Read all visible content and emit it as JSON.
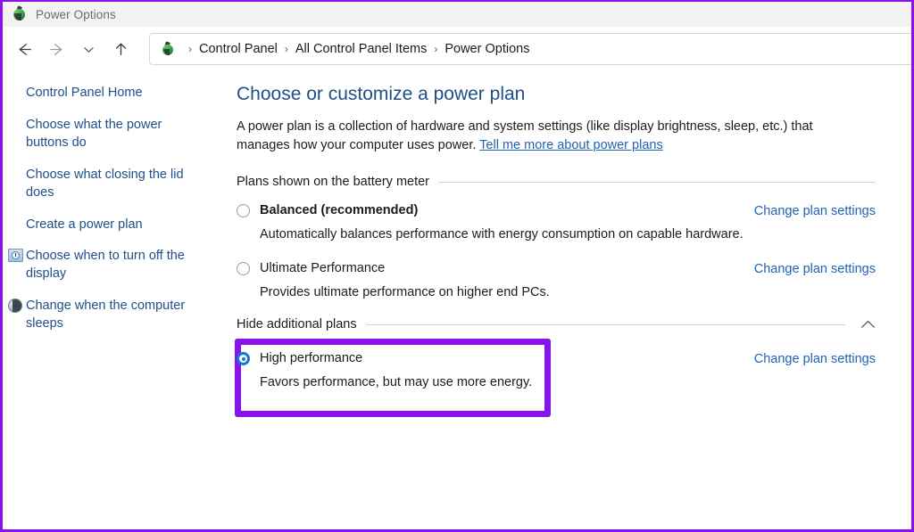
{
  "window": {
    "title": "Power Options",
    "title_icon": "power-options-icon",
    "border_color": "#8A12EC"
  },
  "toolbar": {
    "back": "back-arrow",
    "forward": "forward-arrow",
    "recent": "recent-locations-chevron",
    "up": "up-arrow",
    "breadcrumb": {
      "icon": "control-panel-icon",
      "separator": "›",
      "items": [
        "Control Panel",
        "All Control Panel Items",
        "Power Options"
      ]
    }
  },
  "sidebar": {
    "items": [
      {
        "label": "Control Panel Home",
        "icon": null
      },
      {
        "label": "Choose what the power buttons do",
        "icon": null
      },
      {
        "label": "Choose what closing the lid does",
        "icon": null
      },
      {
        "label": "Create a power plan",
        "icon": null
      },
      {
        "label": "Choose when to turn off the display",
        "icon": "display-clock-icon"
      },
      {
        "label": "Change when the computer sleeps",
        "icon": "sleep-moon-icon"
      }
    ]
  },
  "main": {
    "page_title": "Choose or customize a power plan",
    "intro_text": "A power plan is a collection of hardware and system settings (like display brightness, sleep, etc.) that manages how your computer uses power. ",
    "intro_link": "Tell me more about power plans",
    "link_color": "#1F63B4",
    "groups": [
      {
        "label": "Plans shown on the battery meter",
        "chevron": null,
        "plans": [
          {
            "name": "Balanced (recommended)",
            "bold": true,
            "selected": false,
            "description": "Automatically balances performance with energy consumption on capable hardware.",
            "action_link": "Change plan settings"
          },
          {
            "name": "Ultimate Performance",
            "bold": false,
            "selected": false,
            "description": "Provides ultimate performance on higher end PCs.",
            "action_link": "Change plan settings"
          }
        ]
      },
      {
        "label": "Hide additional plans",
        "chevron": "chevron-up-icon",
        "plans": [
          {
            "name": "High performance",
            "bold": false,
            "selected": true,
            "highlighted": true,
            "description": "Favors performance, but may use more energy.",
            "action_link": "Change plan settings"
          }
        ]
      }
    ]
  }
}
